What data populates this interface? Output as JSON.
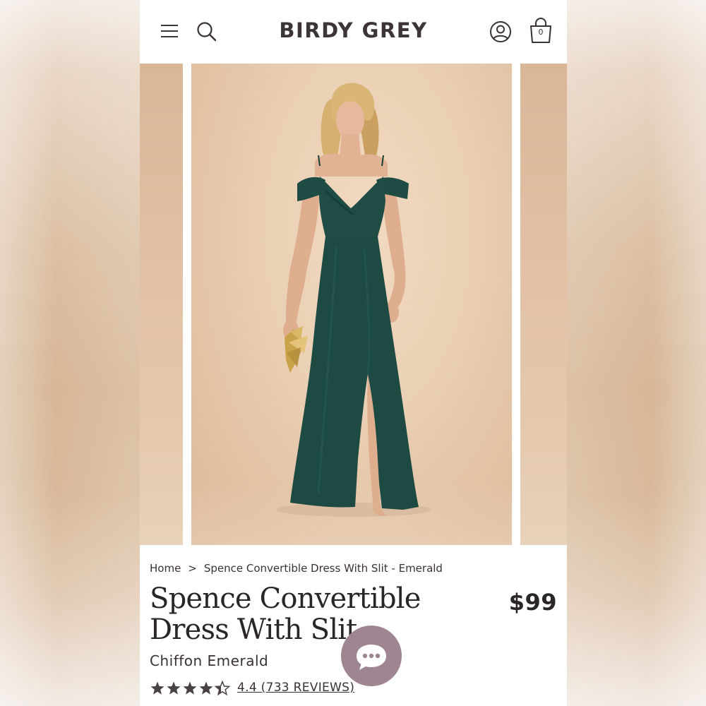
{
  "header": {
    "brand": "BIRDY GREY",
    "menu_icon": "hamburger-menu-icon",
    "search_icon": "search-icon",
    "account_icon": "account-icon",
    "cart_icon": "shopping-bag-icon",
    "cart_count": "0"
  },
  "breadcrumb": {
    "home": "Home",
    "separator": ">",
    "current": "Spence Convertible Dress With Slit - Emerald"
  },
  "product": {
    "title": "Spence Convertible Dress With Slit",
    "price": "$99",
    "variant": "Chiffon Emerald",
    "rating_value": 4.4,
    "rating_max": 5,
    "reviews_label": "4.4 (733 REVIEWS)"
  },
  "colors": {
    "dress": "#1d4a42",
    "backdrop": "#e8cdb1",
    "chat_bubble": "#9e8591",
    "text": "#2b2626"
  },
  "chat": {
    "icon": "chat-bubble-icon"
  }
}
